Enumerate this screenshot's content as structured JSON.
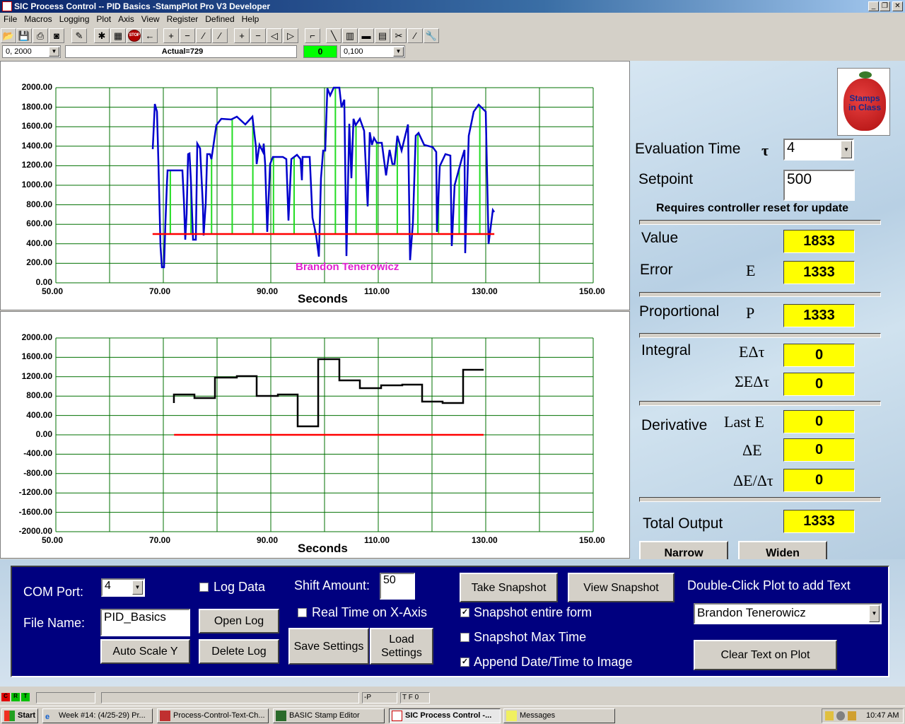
{
  "window": {
    "title": "SIC Process Control -- PID Basics -StampPlot Pro V3 Developer",
    "controls": [
      "_",
      "❐",
      "✕"
    ]
  },
  "menu": [
    "File",
    "Macros",
    "Logging",
    "Plot",
    "Axis",
    "View",
    "Register",
    "Defined",
    "Help"
  ],
  "toolbar": {
    "icons": [
      "open-icon",
      "save-icon",
      "print-icon",
      "camera-icon",
      "wand-icon",
      "debug-icon",
      "monitor-icon",
      "stop-icon",
      "back-arrow-icon",
      "zoom-in-y-icon",
      "zoom-out-y-icon",
      "shift-up-icon",
      "shift-down-icon",
      "zoom-in-x-icon",
      "zoom-out-x-icon",
      "shift-left-icon",
      "shift-right-icon",
      "plot-icon",
      "pen-icon",
      "data-icon",
      "note-icon",
      "clipboard-icon",
      "tool-icon",
      "chart-icon",
      "wrench-icon"
    ],
    "stop_label": "STOP",
    "y_range": "0, 2000",
    "status_text": "Actual=729",
    "indicator": "0",
    "indicator_color": "#00ff00",
    "x_span": "0,100"
  },
  "chart_data": [
    {
      "type": "line",
      "xlabel": "Seconds",
      "xlim": [
        50,
        150
      ],
      "ylim": [
        0,
        2000
      ],
      "x_ticks": [
        "50.00",
        "70.00",
        "90.00",
        "110.00",
        "130.00",
        "150.00"
      ],
      "y_ticks": [
        "2000.00",
        "1800.00",
        "1600.00",
        "1400.00",
        "1200.00",
        "1000.00",
        "800.00",
        "600.00",
        "400.00",
        "200.00",
        "0.00"
      ],
      "grid": true,
      "annotation": "Brandon Tenerowicz",
      "annotation_color": "#e020d0",
      "series": [
        {
          "color": "#0000cc",
          "points": [
            [
              68.03,
              1370
            ],
            [
              68.42,
              1833
            ],
            [
              68.82,
              1754
            ],
            [
              69.08,
              1246
            ],
            [
              69.47,
              377
            ],
            [
              69.74,
              159
            ],
            [
              70.13,
              159
            ],
            [
              70.39,
              616
            ],
            [
              70.66,
              1000
            ],
            [
              70.79,
              1152
            ],
            [
              73.55,
              1152
            ],
            [
              73.82,
              855
            ],
            [
              74.08,
              442
            ],
            [
              74.34,
              710
            ],
            [
              74.61,
              1319
            ],
            [
              74.87,
              1326
            ],
            [
              75.13,
              1051
            ],
            [
              75.53,
              442
            ],
            [
              76.05,
              442
            ],
            [
              76.32,
              1427
            ],
            [
              76.84,
              1377
            ],
            [
              77.37,
              783
            ],
            [
              77.5,
              485
            ],
            [
              77.89,
              812
            ],
            [
              78.16,
              1319
            ],
            [
              78.68,
              1319
            ],
            [
              78.95,
              1268
            ],
            [
              79.87,
              1616
            ],
            [
              80.79,
              1681
            ],
            [
              82.63,
              1674
            ],
            [
              83.68,
              1703
            ],
            [
              85.26,
              1623
            ],
            [
              86.58,
              1703
            ],
            [
              87.24,
              1391
            ],
            [
              87.37,
              1217
            ],
            [
              87.89,
              1413
            ],
            [
              88.55,
              1341
            ],
            [
              88.68,
              1427
            ],
            [
              88.95,
              1217
            ],
            [
              89.34,
              522
            ],
            [
              89.87,
              1217
            ],
            [
              90.39,
              1290
            ],
            [
              92.24,
              1290
            ],
            [
              92.89,
              1268
            ],
            [
              93.29,
              638
            ],
            [
              93.82,
              1268
            ],
            [
              94.87,
              1312
            ],
            [
              95.53,
              1268
            ],
            [
              95.79,
              1051
            ],
            [
              95.92,
              1290
            ],
            [
              97.24,
              1290
            ],
            [
              97.76,
              667
            ],
            [
              98.42,
              493
            ],
            [
              98.95,
              268
            ],
            [
              99.34,
              1072
            ],
            [
              99.74,
              1355
            ],
            [
              100.13,
              1355
            ],
            [
              100.53,
              1993
            ],
            [
              101.05,
              1920
            ],
            [
              101.71,
              2000
            ],
            [
              102.76,
              2000
            ],
            [
              103.16,
              1797
            ],
            [
              103.68,
              1877
            ],
            [
              104.08,
              275
            ],
            [
              104.61,
              1630
            ],
            [
              105.0,
              1072
            ],
            [
              105.39,
              1681
            ],
            [
              105.79,
              1616
            ],
            [
              106.58,
              1681
            ],
            [
              107.37,
              1558
            ],
            [
              108.03,
              783
            ],
            [
              108.42,
              1543
            ],
            [
              108.82,
              1413
            ],
            [
              109.21,
              1485
            ],
            [
              109.74,
              1435
            ],
            [
              110.66,
              1435
            ],
            [
              111.45,
              1101
            ],
            [
              112.11,
              1362
            ],
            [
              112.63,
              1217
            ],
            [
              113.03,
              1217
            ],
            [
              113.55,
              1507
            ],
            [
              114.34,
              1355
            ],
            [
              115.53,
              1623
            ],
            [
              115.92,
              232
            ],
            [
              116.45,
              616
            ],
            [
              116.97,
              1507
            ],
            [
              117.5,
              1536
            ],
            [
              118.55,
              1413
            ],
            [
              120.13,
              1391
            ],
            [
              120.79,
              1341
            ],
            [
              120.92,
              522
            ],
            [
              121.45,
              1196
            ],
            [
              122.5,
              1319
            ],
            [
              123.42,
              1304
            ],
            [
              123.68,
              377
            ],
            [
              124.21,
              1000
            ],
            [
              125.53,
              1268
            ],
            [
              126.05,
              1362
            ],
            [
              126.18,
              304
            ],
            [
              126.84,
              1507
            ],
            [
              127.76,
              1754
            ],
            [
              128.68,
              1826
            ],
            [
              130.0,
              1754
            ],
            [
              130.53,
              399
            ],
            [
              131.32,
              746
            ],
            [
              131.58,
              725
            ]
          ]
        },
        {
          "color": "#ff0000",
          "points": [
            [
              68.0,
              500
            ],
            [
              131.6,
              500
            ]
          ]
        }
      ],
      "sample_lines": {
        "color": "#22dd22",
        "baseline": 500,
        "times": [
          71.3,
          75.14,
          78.98,
          82.82,
          86.66,
          90.5,
          94.34,
          98.18,
          102.02,
          105.86,
          109.7,
          113.54,
          117.38,
          121.22,
          125.06,
          128.9
        ]
      }
    },
    {
      "type": "line",
      "xlabel": "Seconds",
      "xlim": [
        50,
        150
      ],
      "ylim": [
        -2000,
        2000
      ],
      "x_ticks": [
        "50.00",
        "70.00",
        "90.00",
        "110.00",
        "130.00",
        "150.00"
      ],
      "y_ticks": [
        "2000.00",
        "1600.00",
        "1200.00",
        "800.00",
        "400.00",
        "0.00",
        "-400.00",
        "-800.00",
        "-1200.00",
        "-1600.00",
        "-2000.00"
      ],
      "grid": true,
      "series": [
        {
          "color": "#000000",
          "step": true,
          "points": [
            [
              71.97,
              657
            ],
            [
              71.97,
              832
            ],
            [
              75.79,
              759
            ],
            [
              79.61,
              1183
            ],
            [
              83.68,
              1212
            ],
            [
              87.37,
              803
            ],
            [
              91.32,
              832
            ],
            [
              95.0,
              175
            ],
            [
              98.82,
              1562
            ],
            [
              102.76,
              1124
            ],
            [
              106.58,
              964
            ],
            [
              110.53,
              1022
            ],
            [
              114.47,
              1037
            ],
            [
              118.16,
              686
            ],
            [
              121.97,
              657
            ],
            [
              125.79,
              1343
            ],
            [
              129.61,
              1343
            ]
          ]
        },
        {
          "color": "#ff0000",
          "points": [
            [
              72.0,
              0
            ],
            [
              129.6,
              0
            ]
          ]
        }
      ]
    }
  ],
  "right_panel": {
    "logo_text": "Stamps in Class",
    "eval_time_label": "Evaluation Time",
    "eval_time_symbol": "τ",
    "eval_time_value": "4",
    "setpoint_label": "Setpoint",
    "setpoint_value": "500",
    "reset_note": "Requires controller reset for update",
    "value_label": "Value",
    "value": "1833",
    "error_label": "Error",
    "error_symbol": "E",
    "error": "1333",
    "proportional_label": "Proportional",
    "proportional_symbol": "P",
    "proportional": "1333",
    "integral_label": "Integral",
    "integral_symbol1": "EΔτ",
    "integral1": "0",
    "integral_symbol2": "ΣEΔτ",
    "integral2": "0",
    "derivative_label": "Derivative",
    "deriv_symbol1": "Last E",
    "deriv1": "0",
    "deriv_symbol2": "ΔE",
    "deriv2": "0",
    "deriv_symbol3": "ΔE/Δτ",
    "deriv3": "0",
    "total_label": "Total Output",
    "total": "1333",
    "narrow": "Narrow",
    "widen": "Widen"
  },
  "bottom_panel": {
    "com_port_label": "COM Port:",
    "com_port": "4",
    "file_name_label": "File Name:",
    "file_name": "PID_Basics",
    "auto_scale": "Auto Scale Y",
    "log_data": "Log Data",
    "log_data_checked": false,
    "open_log": "Open Log",
    "delete_log": "Delete Log",
    "shift_label": "Shift Amount:",
    "shift_value": "50",
    "real_time": "Real Time on X-Axis",
    "real_time_checked": false,
    "save_settings": "Save Settings",
    "load_settings": "Load Settings",
    "take_snapshot": "Take Snapshot",
    "view_snapshot": "View Snapshot",
    "snapshot_form": "Snapshot entire form",
    "snapshot_form_checked": true,
    "snapshot_max": "Snapshot Max Time",
    "snapshot_max_checked": false,
    "append_date": "Append Date/Time to Image",
    "append_date_checked": true,
    "dbl_click_label": "Double-Click Plot to add Text",
    "plot_text": "Brandon Tenerowicz",
    "clear_text": "Clear Text on Plot"
  },
  "statusbar": {
    "leds": [
      "C",
      "R",
      "T"
    ],
    "field1": "-P",
    "field2": "T F 0"
  },
  "taskbar": {
    "start": "Start",
    "tasks": [
      "Week #14: (4/25-29) Pr...",
      "Process-Control-Text-Ch...",
      "BASIC Stamp Editor",
      "SIC Process Control -...",
      "Messages"
    ],
    "clock": "10:47 AM"
  }
}
